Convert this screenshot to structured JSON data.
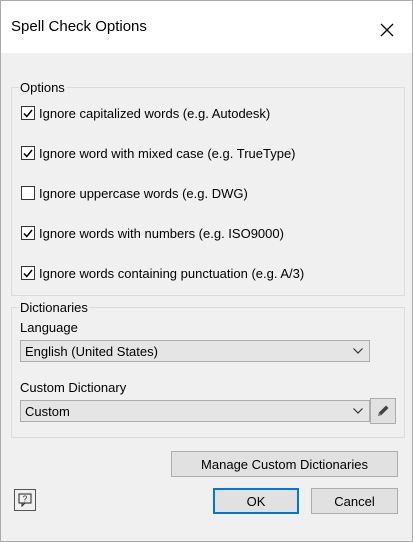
{
  "window": {
    "title": "Spell Check Options"
  },
  "options": {
    "legend": "Options",
    "items": [
      {
        "label": "Ignore capitalized words (e.g. Autodesk)",
        "checked": true
      },
      {
        "label": "Ignore word with mixed case (e.g. TrueType)",
        "checked": true
      },
      {
        "label": "Ignore uppercase words (e.g. DWG)",
        "checked": false
      },
      {
        "label": "Ignore words with numbers (e.g. ISO9000)",
        "checked": true
      },
      {
        "label": "Ignore words containing punctuation (e.g. A/3)",
        "checked": true
      }
    ]
  },
  "dictionaries": {
    "legend": "Dictionaries",
    "language_label": "Language",
    "language_value": "English (United States)",
    "custom_label": "Custom Dictionary",
    "custom_value": "Custom"
  },
  "buttons": {
    "manage": "Manage Custom Dictionaries",
    "ok": "OK",
    "cancel": "Cancel"
  },
  "icons": {
    "close": "close-icon",
    "check": "checkmark-icon",
    "chevron": "chevron-down-icon",
    "edit": "pencil-icon",
    "help": "help-icon"
  },
  "colors": {
    "accent": "#0078d7"
  }
}
